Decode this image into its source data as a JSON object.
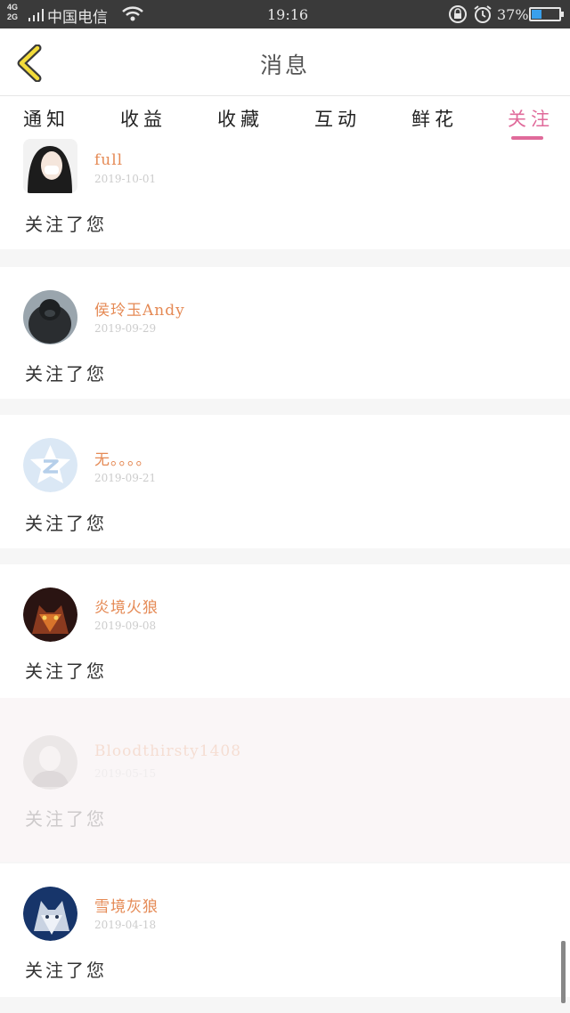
{
  "status_bar": {
    "network_type": "4G\n2G",
    "carrier": "中国电信",
    "time": "19:16",
    "battery_percent": "37%",
    "battery_level": 0.37
  },
  "header": {
    "title": "消息"
  },
  "tabs": [
    {
      "label": "通知",
      "active": false
    },
    {
      "label": "收益",
      "active": false
    },
    {
      "label": "收藏",
      "active": false
    },
    {
      "label": "互动",
      "active": false
    },
    {
      "label": "鲜花",
      "active": false
    },
    {
      "label": "关注",
      "active": true
    }
  ],
  "colors": {
    "accent": "#e06a9a",
    "name": "#e58a55",
    "battery": "#39a0ec"
  },
  "notifications": [
    {
      "name": "full",
      "date": "2019-10-01",
      "action": "关注了您",
      "avatar": "portrait-photo"
    },
    {
      "name": "侯玲玉Andy",
      "date": "2019-09-29",
      "action": "关注了您",
      "avatar": "gorilla-photo"
    },
    {
      "name": "无。。。。",
      "date": "2019-09-21",
      "action": "关注了您",
      "avatar": "default-star-logo"
    },
    {
      "name": "炎境火狼",
      "date": "2019-09-08",
      "action": "关注了您",
      "avatar": "fire-wolf-photo"
    },
    {
      "name": "Bloodthirsty1408",
      "date": "2019-05-15",
      "action": "关注了您",
      "avatar": "sketch-photo"
    },
    {
      "name": "雪境灰狼",
      "date": "2019-04-18",
      "action": "关注了您",
      "avatar": "snow-wolf-photo"
    }
  ]
}
